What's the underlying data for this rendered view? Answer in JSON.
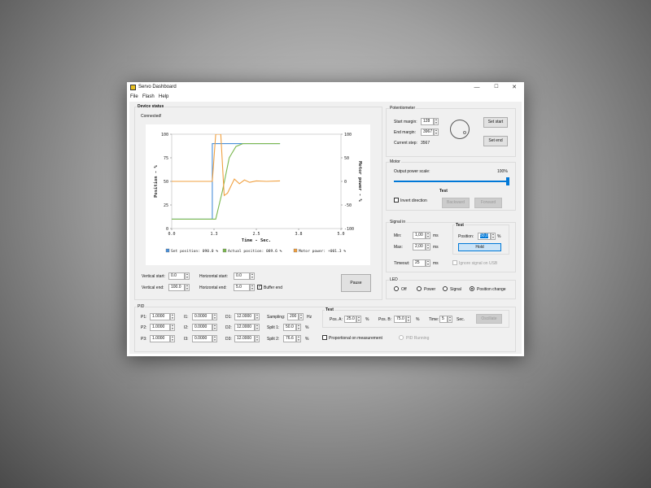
{
  "window": {
    "title": "Servo Dashboard",
    "min": "—",
    "max": "☐",
    "close": "✕",
    "icon": "servo-app-icon"
  },
  "menu": [
    "File",
    "Flash",
    "Help"
  ],
  "device_status": {
    "title": "Device status",
    "status": "Connected!",
    "vertical_start_label": "Vertical start:",
    "vertical_start": "0.0",
    "vertical_end_label": "Vertical end:",
    "vertical_end": "100.0",
    "horizontal_start_label": "Horizontal start:",
    "horizontal_start": "0.0",
    "horizontal_end_label": "Horizontal end:",
    "horizontal_end": "5.0",
    "buffer_end_label": "Buffer end",
    "buffer_end_checked": true,
    "pause_label": "Pause"
  },
  "chart_data": {
    "type": "line",
    "xlabel": "Time - Sec.",
    "ylabel": "Position - %",
    "y2label": "Motor power - %",
    "xlim": [
      0,
      5
    ],
    "ylim": [
      0,
      100
    ],
    "y2lim": [
      -100,
      100
    ],
    "x_ticks": [
      "0.0",
      "1.3",
      "2.5",
      "3.8",
      "5.0"
    ],
    "y_ticks": [
      "0",
      "25",
      "50",
      "75",
      "100"
    ],
    "y2_ticks": [
      "-100",
      "-50",
      "0",
      "50",
      "100"
    ],
    "series": [
      {
        "name": "Set position: 090.0 %",
        "color": "#4a90d9",
        "axis": "left",
        "x": [
          0,
          1.2,
          1.2,
          3.2
        ],
        "y": [
          10,
          10,
          90,
          90
        ]
      },
      {
        "name": "Actual position: 089.6 %",
        "color": "#7cb850",
        "axis": "left",
        "x": [
          0,
          1.3,
          1.5,
          1.7,
          1.9,
          2.1,
          2.3,
          2.6,
          3.2
        ],
        "y": [
          10,
          10,
          40,
          75,
          87,
          90,
          90,
          90,
          90
        ]
      },
      {
        "name": "Motor power: +001.3 %",
        "color": "#f0a040",
        "axis": "right",
        "x": [
          0,
          1.2,
          1.3,
          1.45,
          1.55,
          1.65,
          1.75,
          1.85,
          2.0,
          2.15,
          2.3,
          2.5,
          2.8,
          3.2
        ],
        "y": [
          0,
          0,
          100,
          100,
          -30,
          -25,
          -10,
          5,
          -5,
          3,
          -2,
          1,
          0,
          1
        ]
      }
    ]
  },
  "potentiometer": {
    "title": "Potentiometer",
    "start_margin_label": "Start margin:",
    "start_margin": "128",
    "end_margin_label": "End margin:",
    "end_margin": "3967",
    "current_step_label": "Current step:",
    "current_step": "3567",
    "set_start": "Set start",
    "set_end": "Set end"
  },
  "motor": {
    "title": "Motor",
    "output_power_label": "Output power scale:",
    "output_power_value": "100%",
    "output_power_fraction": 1.0,
    "invert_label": "Invert direction",
    "test_label": "Test",
    "backward": "Backward",
    "forward": "Forward"
  },
  "signal_in": {
    "title": "Signal in",
    "min_label": "Min:",
    "min": "1,00",
    "min_unit": "ms",
    "max_label": "Max:",
    "max": "2,00",
    "max_unit": "ms",
    "timeout_label": "Timeout:",
    "timeout": "25",
    "timeout_unit": "ms",
    "test_label": "Test",
    "position_label": "Position:",
    "position": "50,0",
    "position_unit": "%",
    "hold": "Hold",
    "ignore_label": "Ignore signal on USB"
  },
  "led": {
    "title": "LED",
    "options": [
      "Off",
      "Power",
      "Signal",
      "Position change"
    ],
    "selected": "Position change"
  },
  "pid": {
    "title": "PID",
    "rows": [
      {
        "p_label": "P1:",
        "p": "1.0000",
        "i_label": "I1:",
        "i": "0.0000",
        "d_label": "D1:",
        "d": "12.0000"
      },
      {
        "p_label": "P2:",
        "p": "1.0000",
        "i_label": "I2:",
        "i": "0.0000",
        "d_label": "D2:",
        "d": "12.0000"
      },
      {
        "p_label": "P3:",
        "p": "1.0000",
        "i_label": "I3:",
        "i": "0.0000",
        "d_label": "D3:",
        "d": "12.0000"
      }
    ],
    "sampling_label": "Sampling:",
    "sampling": "200",
    "sampling_unit": "Hz",
    "split1_label": "Split 1:",
    "split1": "50.0",
    "split1_unit": "%",
    "split2_label": "Split 2:",
    "split2": "76.6",
    "split2_unit": "%",
    "test_label": "Test",
    "pos_a_label": "Pos. A:",
    "pos_a": "25.0",
    "pos_a_unit": "%",
    "pos_b_label": "Pos. B:",
    "pos_b": "75.0",
    "pos_b_unit": "%",
    "time_label": "Time:",
    "time": "5",
    "time_unit": "Sec.",
    "oscillate": "Oscillate",
    "proportional_label": "Proportional on measurement",
    "pid_running_label": "PID Running"
  }
}
